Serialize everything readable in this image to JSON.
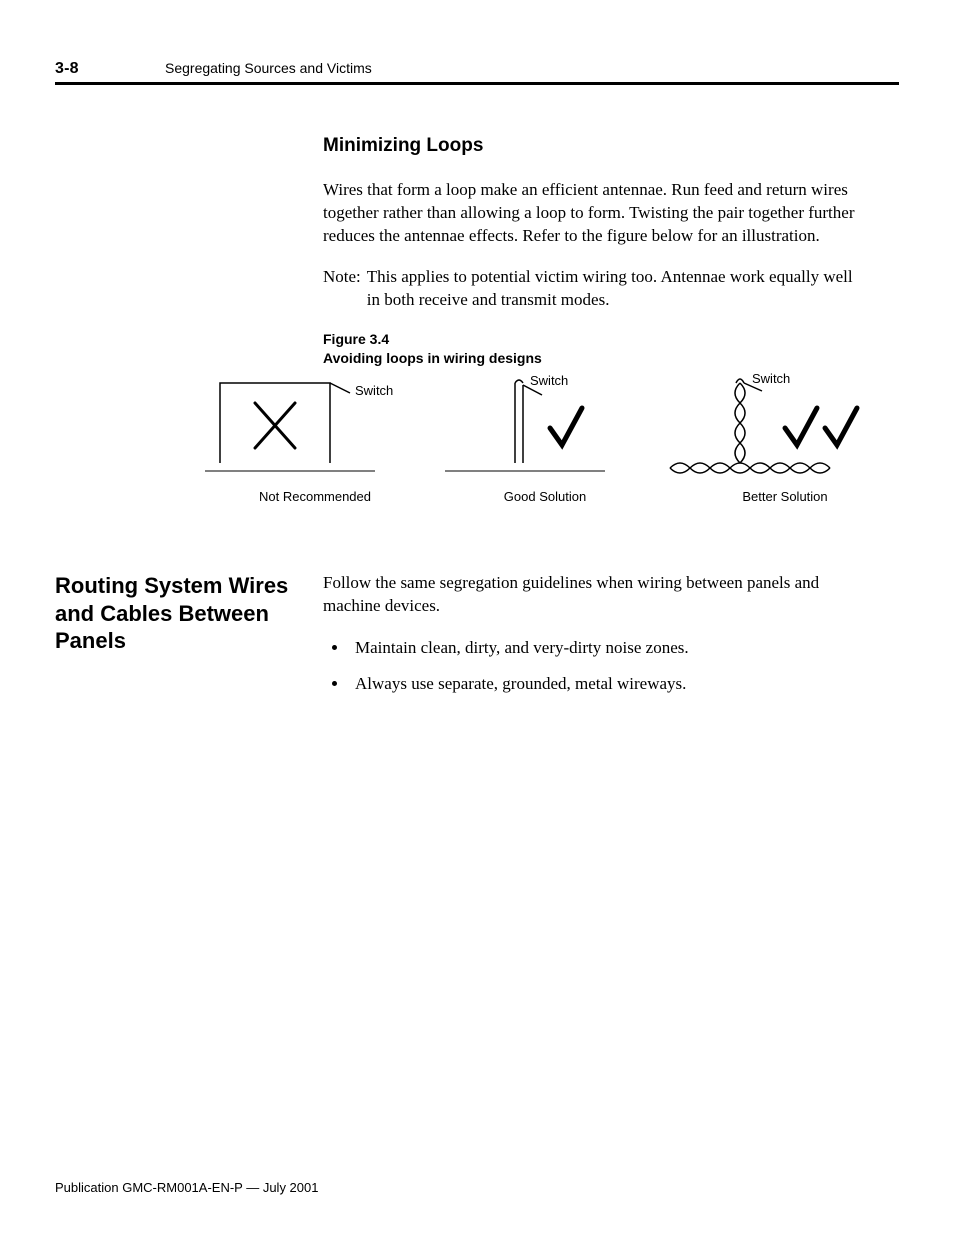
{
  "header": {
    "page_num": "3-8",
    "chapter": "Segregating Sources and Victims"
  },
  "section1": {
    "heading": "Minimizing Loops",
    "para1": "Wires that form a loop make an efficient antennae. Run feed and return wires together rather than allowing a loop to form. Twisting the pair together further reduces the antennae effects. Refer to the figure below for an illustration.",
    "note_label": "Note:",
    "note_body": "This applies to potential victim wiring too. Antennae work equally well in both receive and transmit modes."
  },
  "figure": {
    "label1": "Figure 3.4",
    "label2": "Avoiding loops in wiring designs",
    "switch_label": "Switch",
    "panels": {
      "a": "Not Recommended",
      "b": "Good Solution",
      "c": "Better Solution"
    }
  },
  "section2": {
    "heading": "Routing System Wires and Cables Between Panels",
    "intro": "Follow the same segregation guidelines when wiring between panels and machine devices.",
    "bullets": [
      "Maintain clean, dirty, and very-dirty noise zones.",
      "Always use separate, grounded, metal wireways."
    ]
  },
  "footer": "Publication GMC-RM001A-EN-P — July 2001"
}
